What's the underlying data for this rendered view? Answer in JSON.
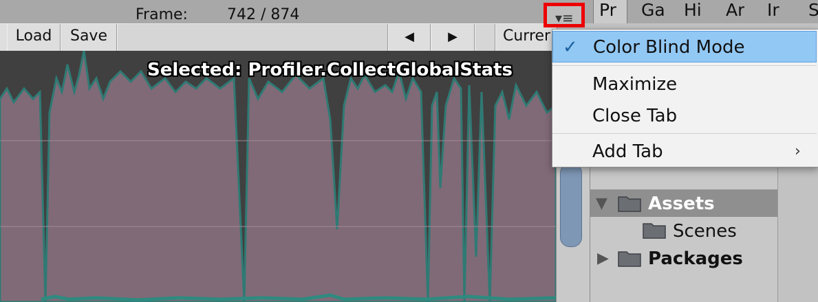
{
  "tabs": {
    "labels": [
      "Pr",
      "Ga",
      "Hi",
      "Ar",
      "Ir",
      "S"
    ]
  },
  "toolbar": {
    "load_label": "Load",
    "save_label": "Save",
    "frame_label": "Frame:",
    "frame_value": "742 / 874",
    "current_label": "Currer"
  },
  "graph": {
    "selected_caption": "Selected: Profiler.CollectGlobalStats"
  },
  "menu": {
    "color_blind_label": "Color Blind Mode",
    "maximize_label": "Maximize",
    "close_tab_label": "Close Tab",
    "add_tab_label": "Add Tab"
  },
  "project": {
    "assets_label": "Assets",
    "scenes_label": "Scenes",
    "packages_label": "Packages"
  },
  "colors": {
    "highlight": "#ee0000",
    "menu_selection": "#92c8f4",
    "graph_fill": "#806a77",
    "graph_bg": "#404040"
  }
}
